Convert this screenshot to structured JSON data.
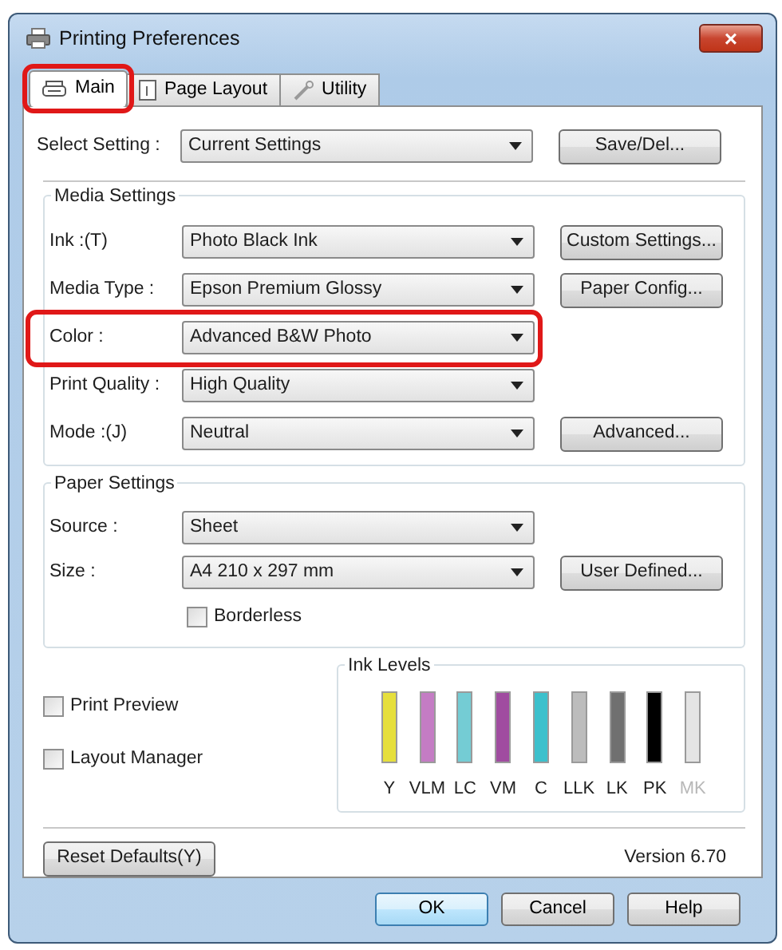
{
  "window": {
    "title": "Printing Preferences",
    "close": "×"
  },
  "tabs": [
    {
      "label": "Main",
      "selected": true,
      "highlighted": true
    },
    {
      "label": "Page Layout",
      "selected": false,
      "highlighted": false
    },
    {
      "label": "Utility",
      "selected": false,
      "highlighted": false
    }
  ],
  "select_setting": {
    "label": "Select Setting :",
    "value": "Current Settings",
    "button": "Save/Del..."
  },
  "media_settings": {
    "title": "Media Settings",
    "rows": [
      {
        "label": "Ink :(T)",
        "value": "Photo Black Ink",
        "button": "Custom Settings...",
        "highlighted": false
      },
      {
        "label": "Media Type :",
        "value": "Epson Premium Glossy",
        "button": "Paper Config...",
        "highlighted": false
      },
      {
        "label": "Color :",
        "value": "Advanced B&W Photo",
        "highlighted": true
      },
      {
        "label": "Print Quality :",
        "value": "High Quality",
        "highlighted": false
      },
      {
        "label": "Mode :(J)",
        "value": "Neutral",
        "button": "Advanced...",
        "highlighted": false
      }
    ]
  },
  "paper_settings": {
    "title": "Paper Settings",
    "rows": [
      {
        "label": "Source :",
        "value": "Sheet"
      },
      {
        "label": "Size :",
        "value": "A4 210 x 297 mm",
        "button": "User Defined..."
      }
    ],
    "borderless": {
      "label": "Borderless",
      "checked": false
    }
  },
  "options": [
    {
      "label": "Print Preview",
      "checked": false
    },
    {
      "label": "Layout Manager",
      "checked": false
    }
  ],
  "ink_levels": {
    "title": "Ink Levels",
    "inks": [
      {
        "label": "Y",
        "color": "#e6df3c",
        "level": 1,
        "disabled": false
      },
      {
        "label": "VLM",
        "color": "#c47cc4",
        "level": 1,
        "disabled": false
      },
      {
        "label": "LC",
        "color": "#74ccd4",
        "level": 1,
        "disabled": false
      },
      {
        "label": "VM",
        "color": "#a04ca0",
        "level": 1,
        "disabled": false
      },
      {
        "label": "C",
        "color": "#3cc0cc",
        "level": 1,
        "disabled": false
      },
      {
        "label": "LLK",
        "color": "#bcbcbc",
        "level": 1,
        "disabled": false
      },
      {
        "label": "LK",
        "color": "#707070",
        "level": 1,
        "disabled": false
      },
      {
        "label": "PK",
        "color": "#000000",
        "level": 1,
        "disabled": false
      },
      {
        "label": "MK",
        "color": "#e4e4e4",
        "level": 1,
        "disabled": true
      }
    ]
  },
  "reset_button": "Reset Defaults(Y)",
  "version": "Version 6.70",
  "buttons": [
    {
      "label": "OK",
      "default": true
    },
    {
      "label": "Cancel",
      "default": false
    },
    {
      "label": "Help",
      "default": false
    }
  ]
}
